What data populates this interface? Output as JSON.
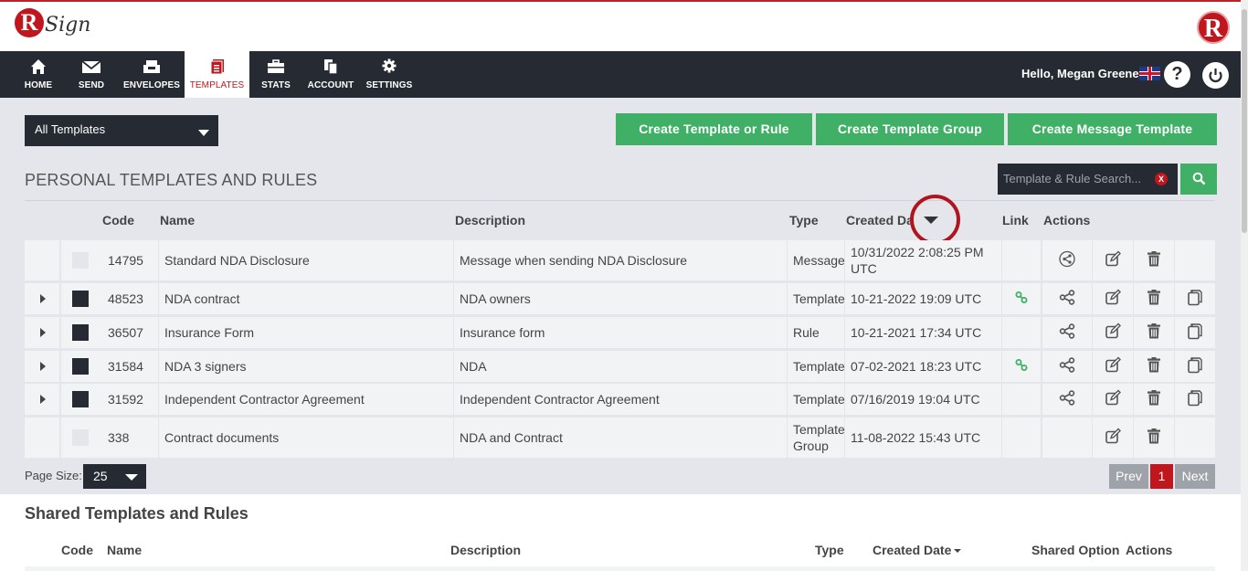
{
  "brand": {
    "logo_text": "Sign"
  },
  "nav": {
    "items": [
      {
        "label": "HOME",
        "icon": "home-icon"
      },
      {
        "label": "SEND",
        "icon": "envelope-icon"
      },
      {
        "label": "ENVELOPES",
        "icon": "inbox-icon"
      },
      {
        "label": "TEMPLATES",
        "icon": "templates-icon",
        "active": true
      },
      {
        "label": "STATS",
        "icon": "briefcase-icon"
      },
      {
        "label": "ACCOUNT",
        "icon": "documents-icon"
      },
      {
        "label": "SETTINGS",
        "icon": "gear-icon"
      }
    ],
    "greeting": "Hello, Megan Greene"
  },
  "toolbar": {
    "filter_value": "All Templates",
    "create_template_or_rule": "Create Template or Rule",
    "create_template_group": "Create Template Group",
    "create_message_template": "Create Message Template"
  },
  "personal": {
    "title": "PERSONAL TEMPLATES AND RULES",
    "search_placeholder": "Template & Rule Search...",
    "search_clear": "X",
    "columns": {
      "code": "Code",
      "name": "Name",
      "description": "Description",
      "type": "Type",
      "created_date": "Created Da",
      "link": "Link",
      "actions": "Actions"
    },
    "rows": [
      {
        "code": "14795",
        "name": "Standard NDA Disclosure",
        "description": "Message when sending NDA Disclosure",
        "type": "Message",
        "created": "10/31/2022 2:08:25 PM UTC",
        "expandable": false,
        "link": false,
        "copy": false
      },
      {
        "code": "48523",
        "name": "NDA contract",
        "description": "NDA owners",
        "type": "Template",
        "created": "10-21-2022 19:09 UTC",
        "expandable": true,
        "link": true,
        "copy": true
      },
      {
        "code": "36507",
        "name": "Insurance Form",
        "description": "Insurance form",
        "type": "Rule",
        "created": "10-21-2021 17:34 UTC",
        "expandable": true,
        "link": false,
        "copy": true
      },
      {
        "code": "31584",
        "name": "NDA 3 signers",
        "description": "NDA",
        "type": "Template",
        "created": "07-02-2021 18:23 UTC",
        "expandable": true,
        "link": true,
        "copy": true
      },
      {
        "code": "31592",
        "name": "Independent Contractor Agreement",
        "description": "Independent Contractor Agreement",
        "type": "Template",
        "created": "07/16/2019 19:04 UTC",
        "expandable": true,
        "link": false,
        "copy": true
      },
      {
        "code": "338",
        "name": "Contract documents",
        "description": "NDA and Contract",
        "type": "Template Group",
        "created": "11-08-2022 15:43 UTC",
        "expandable": false,
        "link": false,
        "copy": false
      }
    ],
    "page_size_label": "Page Size:",
    "page_size": "25",
    "pagination": {
      "prev": "Prev",
      "current": "1",
      "next": "Next"
    }
  },
  "shared": {
    "title": "Shared Templates and Rules",
    "columns": {
      "code": "Code",
      "name": "Name",
      "description": "Description",
      "type": "Type",
      "created_date": "Created Date",
      "shared_option": "Shared Option",
      "actions": "Actions"
    }
  },
  "colors": {
    "brand_red": "#c0161d",
    "nav_dark": "#252a33",
    "green": "#3fb065",
    "page_bg": "#e4e6ec"
  }
}
